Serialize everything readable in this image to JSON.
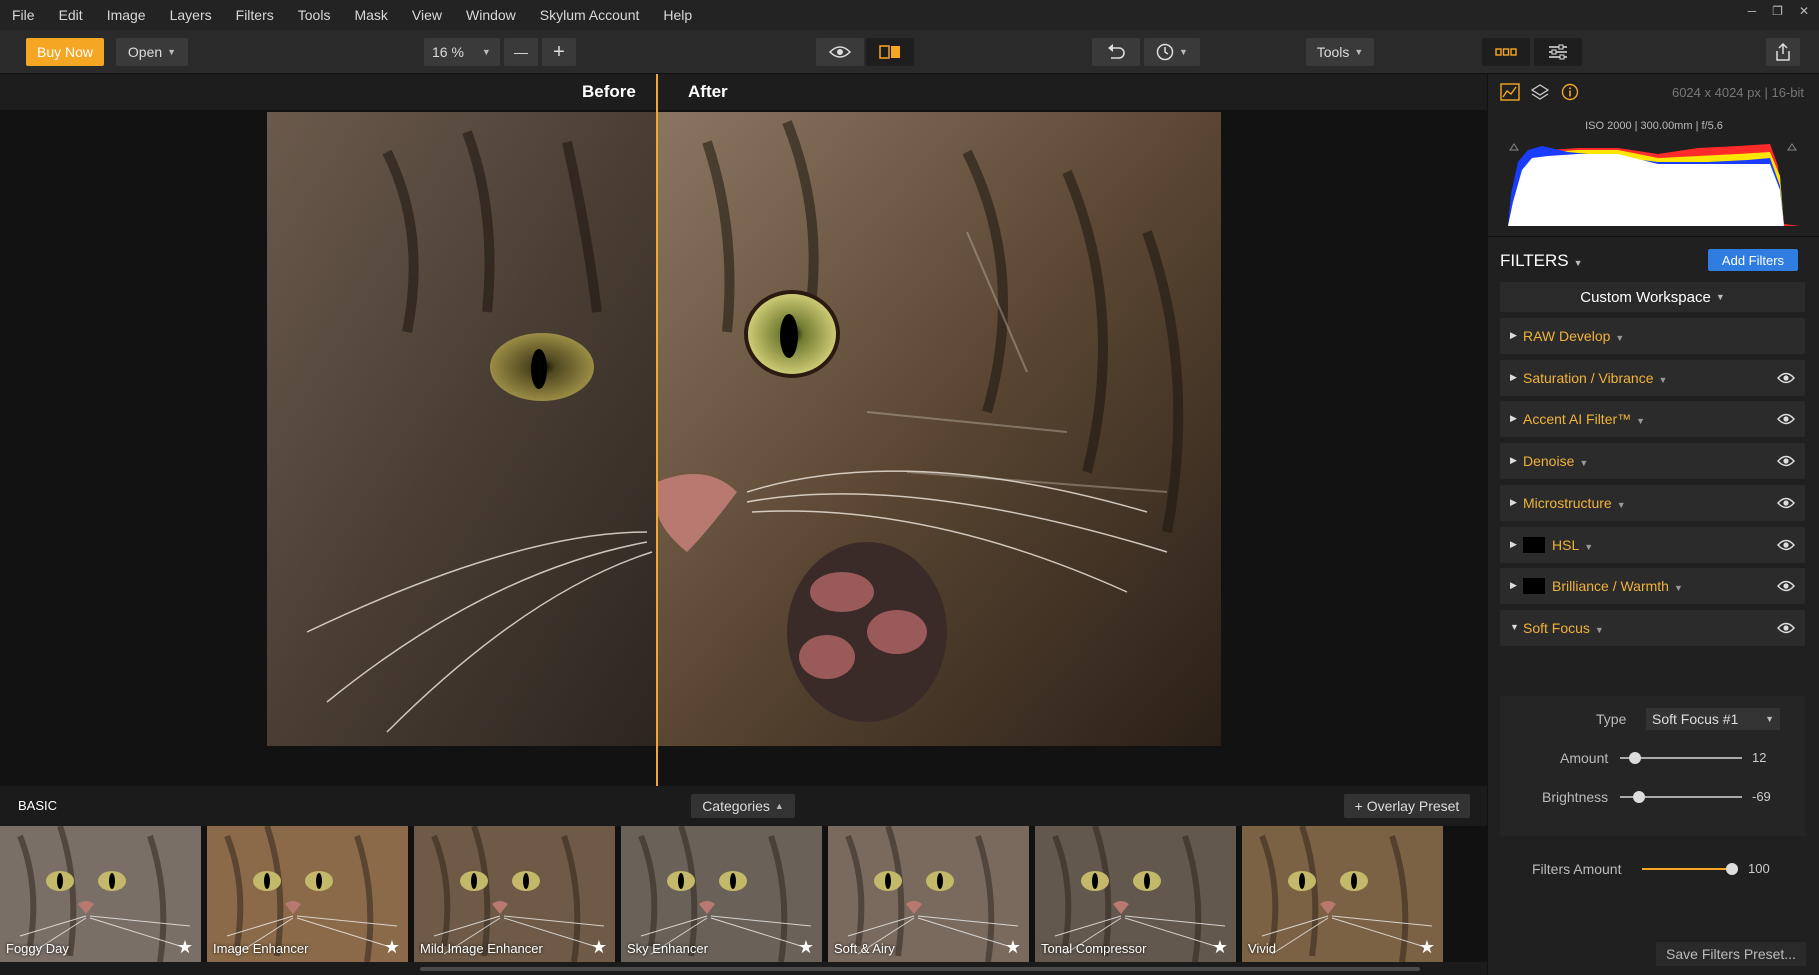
{
  "menu": [
    "File",
    "Edit",
    "Image",
    "Layers",
    "Filters",
    "Tools",
    "Mask",
    "View",
    "Window",
    "Skylum Account",
    "Help"
  ],
  "toolbar": {
    "buy_now": "Buy Now",
    "open": "Open",
    "zoom": "16 %",
    "zoom_out": "—",
    "zoom_in": "+",
    "tools": "Tools"
  },
  "canvas": {
    "before": "Before",
    "after": "After"
  },
  "presets": {
    "section": "BASIC",
    "categories": "Categories",
    "overlay": "+ Overlay Preset",
    "items": [
      {
        "name": "Foggy Day"
      },
      {
        "name": "Image Enhancer"
      },
      {
        "name": "Mild Image Enhancer"
      },
      {
        "name": "Sky Enhancer"
      },
      {
        "name": "Soft & Airy"
      },
      {
        "name": "Tonal Compressor"
      },
      {
        "name": "Vivid"
      }
    ]
  },
  "panel": {
    "image_size": "6024 x 4024 px | 16-bit",
    "exif": "ISO 2000  |  300.00mm  |  f/5.6",
    "filters_title": "FILTERS",
    "add_filters": "Add Filters",
    "workspace": "Custom Workspace",
    "filters": [
      {
        "name": "RAW Develop",
        "eye": false,
        "thumb": false,
        "open": false
      },
      {
        "name": "Saturation / Vibrance",
        "eye": true,
        "thumb": false,
        "open": false
      },
      {
        "name": "Accent AI Filter™",
        "eye": true,
        "thumb": false,
        "open": false
      },
      {
        "name": "Denoise",
        "eye": true,
        "thumb": false,
        "open": false
      },
      {
        "name": "Microstructure",
        "eye": true,
        "thumb": false,
        "open": false
      },
      {
        "name": "HSL",
        "eye": true,
        "thumb": true,
        "open": false
      },
      {
        "name": "Brilliance / Warmth",
        "eye": true,
        "thumb": true,
        "open": false
      },
      {
        "name": "Soft Focus",
        "eye": true,
        "thumb": false,
        "open": true
      }
    ],
    "soft_focus": {
      "type_label": "Type",
      "type_value": "Soft Focus #1",
      "amount_label": "Amount",
      "amount_value": "12",
      "amount_fraction": 0.12,
      "brightness_label": "Brightness",
      "brightness_value": "-69",
      "brightness_fraction": 0.155
    },
    "filters_amount_label": "Filters Amount",
    "filters_amount_value": "100",
    "filters_amount_fraction": 1.0,
    "save_preset": "Save Filters Preset..."
  },
  "colors": {
    "accent": "#f5a623",
    "filter_name": "#f0b33a",
    "button_blue": "#2f7de1"
  }
}
